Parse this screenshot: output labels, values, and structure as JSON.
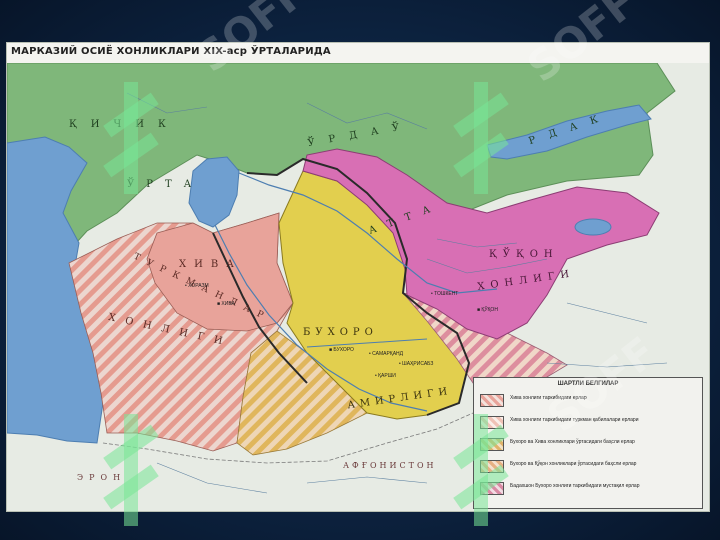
{
  "map": {
    "title": "МАРКАЗИЙ ОСИЁ ХОНЛИКЛАРИ XIX-аср ЎРТАЛАРИДА",
    "colors": {
      "kazakh": "#7fb77a",
      "kokand": "#d86fb4",
      "bukhara": "#e2cf4e",
      "khiva": "#e8a39a",
      "caspian": "#6f9fd0",
      "land": "#e7ebe4",
      "border": "#2a2a2a"
    },
    "region_labels": {
      "kazakh_letters": [
        "Қ",
        "И",
        "Ч",
        "И",
        "К",
        "Ў",
        "Р",
        "Т",
        "А",
        "Ў",
        "Р",
        "Д",
        "А",
        "Ў",
        "Р",
        "Д",
        "А",
        "К",
        "А",
        "Т",
        "Т",
        "А"
      ],
      "kokand_name": "ҚЎҚОН",
      "kokand_suffix": "ХОНЛИГИ",
      "bukhara_name": "БУХОРО",
      "bukhara_suffix": "АМИРЛИГИ",
      "khiva_name": "ХИВА",
      "khiva_suffix": "ХОНЛИГИ",
      "turkmen_name": "ТУРКМАНЛАР",
      "afghanistan": "АФҒОНИСТОН",
      "iran": "ЭРОН"
    },
    "cities": [
      {
        "name": "ХИВА",
        "capital": true
      },
      {
        "name": "БУХОРО",
        "capital": true
      },
      {
        "name": "ҚЎҚОН",
        "capital": true
      },
      {
        "name": "САМАРҚАНД",
        "capital": false
      },
      {
        "name": "ТОШКЕНТ",
        "capital": false
      },
      {
        "name": "ҚАРШИ",
        "capital": false
      },
      {
        "name": "ШАҲРИСАБЗ",
        "capital": false
      },
      {
        "name": "ХОРАЗМ",
        "capital": false
      }
    ],
    "legend": {
      "title": "ШАРТЛИ БЕЛГИЛАР",
      "items": [
        {
          "text": "Хива хонлиги таркибидаги ерлар",
          "color": "#e8a39a",
          "striped": true
        },
        {
          "text": "Хива хонлиги таркибидаги туркман қабилалари ерлари",
          "color": "#f0c2b6",
          "striped": true
        },
        {
          "text": "Бухоро ва Хива хонликлари ўртасидаги баҳсли ерлар",
          "color": "#e0b36a",
          "striped": true
        },
        {
          "text": "Бухоро ва Қўқон хонликлари ўртасидаги баҳсли ерлар",
          "color": "#e6b084",
          "striped": true
        },
        {
          "text": "Бадахшон Бухоро хонлиги таркибидаги мустақил ерлар",
          "color": "#d98aa4",
          "striped": true
        }
      ]
    }
  },
  "watermark": {
    "text": "SOFF"
  }
}
